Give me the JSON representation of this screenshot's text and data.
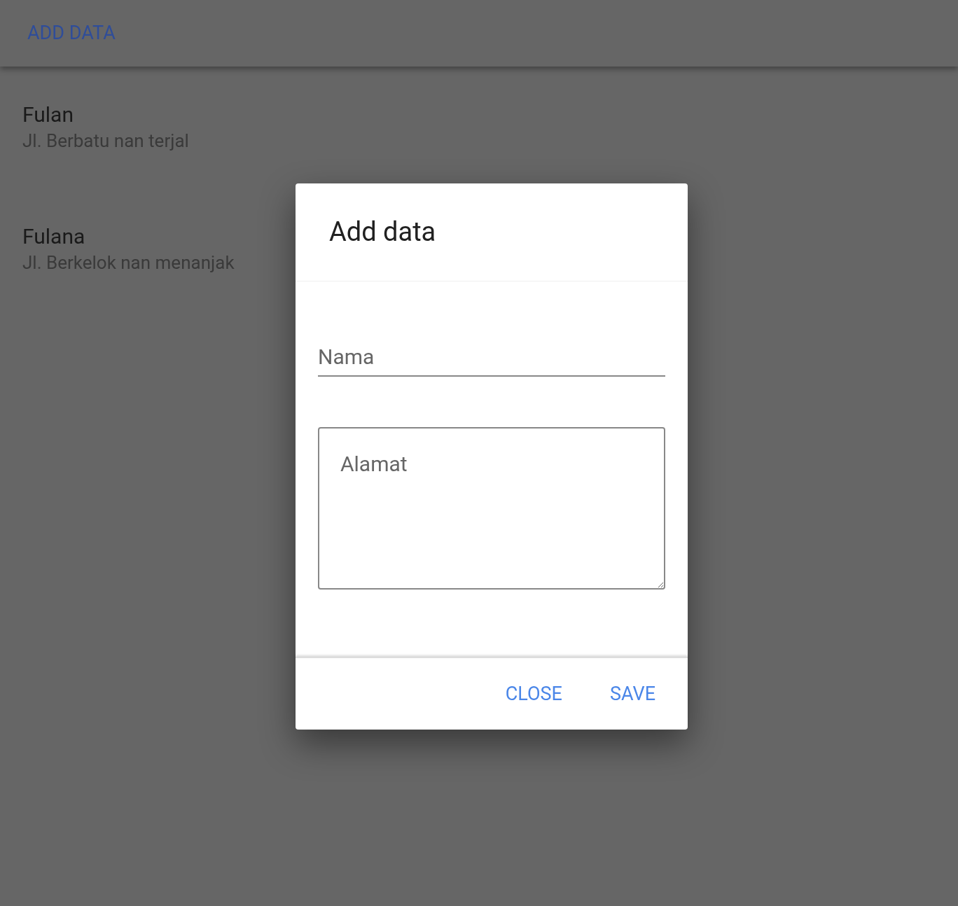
{
  "toolbar": {
    "button": "ADD DATA"
  },
  "list": [
    {
      "name": "Fulan",
      "address": "Jl. Berbatu nan terjal"
    },
    {
      "name": "Fulana",
      "address": "Jl. Berkelok nan menanjak"
    }
  ],
  "dialog": {
    "title": "Add data",
    "name_field": {
      "placeholder": "Nama"
    },
    "address_field": {
      "placeholder": "Alamat"
    },
    "buttons": [
      "CLOSE",
      "SAVE"
    ]
  }
}
